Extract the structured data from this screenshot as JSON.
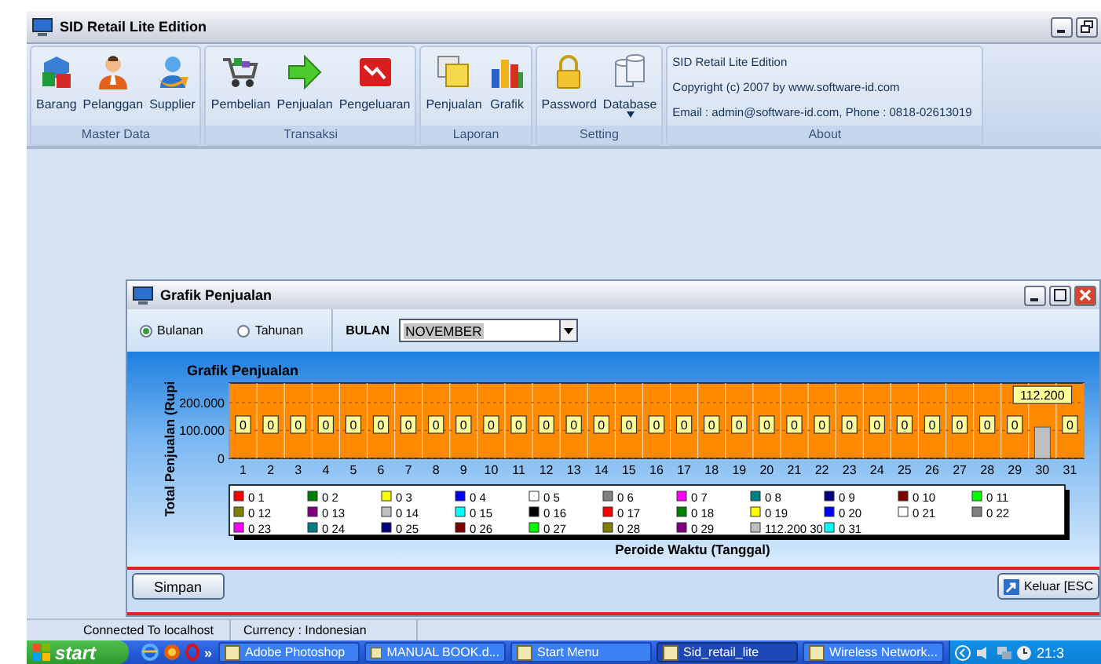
{
  "window": {
    "title": "SID Retail Lite Edition"
  },
  "ribbon": {
    "groups": [
      {
        "caption": "Master Data",
        "buttons": [
          {
            "label": "Barang",
            "menu": false
          },
          {
            "label": "Pelanggan",
            "menu": false
          },
          {
            "label": "Supplier",
            "menu": false
          }
        ]
      },
      {
        "caption": "Transaksi",
        "buttons": [
          {
            "label": "Pembelian",
            "menu": false
          },
          {
            "label": "Penjualan",
            "menu": false
          },
          {
            "label": "Pengeluaran",
            "menu": false
          }
        ]
      },
      {
        "caption": "Laporan",
        "buttons": [
          {
            "label": "Penjualan",
            "menu": false
          },
          {
            "label": "Grafik",
            "menu": false
          }
        ]
      },
      {
        "caption": "Setting",
        "buttons": [
          {
            "label": "Password",
            "menu": false
          },
          {
            "label": "Database",
            "menu": true
          }
        ]
      }
    ],
    "about": {
      "caption": "About",
      "lines": [
        "SID Retail Lite Edition",
        "Copyright (c) 2007 by www.software-id.com",
        "Email : admin@software-id.com, Phone : 0818-02613019"
      ]
    }
  },
  "child_window": {
    "title": "Grafik Penjualan",
    "radios": [
      {
        "label": "Bulanan",
        "selected": true
      },
      {
        "label": "Tahunan",
        "selected": false
      }
    ],
    "month_field": {
      "label": "BULAN",
      "value": "NOVEMBER"
    },
    "chart": {
      "chart_data": {
        "type": "bar",
        "title": "Grafik Penjualan",
        "xlabel": "Peroide Waktu (Tanggal)",
        "ylabel": "Total Penjualan (Rupi",
        "categories": [
          "1",
          "2",
          "3",
          "4",
          "5",
          "6",
          "7",
          "8",
          "9",
          "10",
          "11",
          "12",
          "13",
          "14",
          "15",
          "16",
          "17",
          "18",
          "19",
          "20",
          "21",
          "22",
          "23",
          "24",
          "25",
          "26",
          "27",
          "28",
          "29",
          "30",
          "31"
        ],
        "values": [
          0,
          0,
          0,
          0,
          0,
          0,
          0,
          0,
          0,
          0,
          0,
          0,
          0,
          0,
          0,
          0,
          0,
          0,
          0,
          0,
          0,
          0,
          0,
          0,
          0,
          0,
          0,
          0,
          0,
          112200,
          0
        ],
        "ylim": [
          0,
          270000
        ],
        "yticks": [
          {
            "value": 0,
            "label": "0"
          },
          {
            "value": 100000,
            "label": "100.000"
          },
          {
            "value": 200000,
            "label": "200.000"
          }
        ],
        "value_labels": [
          "0",
          "0",
          "0",
          "0",
          "0",
          "0",
          "0",
          "0",
          "0",
          "0",
          "0",
          "0",
          "0",
          "0",
          "0",
          "0",
          "0",
          "0",
          "0",
          "0",
          "0",
          "0",
          "0",
          "0",
          "0",
          "0",
          "0",
          "0",
          "0",
          "112.200",
          "0"
        ]
      },
      "legend": [
        {
          "label": "0 1",
          "color": "#ff0000"
        },
        {
          "label": "0 2",
          "color": "#008000"
        },
        {
          "label": "0 3",
          "color": "#ffff00"
        },
        {
          "label": "0 4",
          "color": "#0000ff"
        },
        {
          "label": "0 5",
          "color": "#ffffff"
        },
        {
          "label": "0 6",
          "color": "#808080"
        },
        {
          "label": "0 7",
          "color": "#ff00ff"
        },
        {
          "label": "0 8",
          "color": "#008080"
        },
        {
          "label": "0 9",
          "color": "#000080"
        },
        {
          "label": "0 10",
          "color": "#800000"
        },
        {
          "label": "0 11",
          "color": "#00ff00"
        },
        {
          "label": "0 12",
          "color": "#808000"
        },
        {
          "label": "0 13",
          "color": "#800080"
        },
        {
          "label": "0 14",
          "color": "#c0c0c0"
        },
        {
          "label": "0 15",
          "color": "#00ffff"
        },
        {
          "label": "0 16",
          "color": "#000000"
        },
        {
          "label": "0 17",
          "color": "#ff0000"
        },
        {
          "label": "0 18",
          "color": "#008000"
        },
        {
          "label": "0 19",
          "color": "#ffff00"
        },
        {
          "label": "0 20",
          "color": "#0000ff"
        },
        {
          "label": "0 21",
          "color": "#ffffff"
        },
        {
          "label": "0 22",
          "color": "#808080"
        },
        {
          "label": "0 23",
          "color": "#ff00ff"
        },
        {
          "label": "0 24",
          "color": "#008080"
        },
        {
          "label": "0 25",
          "color": "#000080"
        },
        {
          "label": "0 26",
          "color": "#800000"
        },
        {
          "label": "0 27",
          "color": "#00ff00"
        },
        {
          "label": "0 28",
          "color": "#808000"
        },
        {
          "label": "0 29",
          "color": "#800080"
        },
        {
          "label": "112.200 30",
          "color": "#c0c0c0"
        },
        {
          "label": "0 31",
          "color": "#00ffff"
        }
      ]
    },
    "buttons": [
      {
        "label": "Simpan",
        "kind": "plain"
      },
      {
        "label": "Keluar [ESC",
        "kind": "exit"
      }
    ]
  },
  "status_bar": [
    "Connected To localhost",
    "Currency : Indonesian"
  ],
  "taskbar": {
    "start": "start",
    "more": "»",
    "tasks": [
      {
        "label": "Adobe Photoshop",
        "selected": false
      },
      {
        "label": "MANUAL BOOK.d...",
        "selected": false
      },
      {
        "label": "Start Menu",
        "selected": false
      },
      {
        "label": "Sid_retail_lite",
        "selected": true
      },
      {
        "label": "Wireless Network...",
        "selected": false
      }
    ],
    "clock": "21:3"
  }
}
